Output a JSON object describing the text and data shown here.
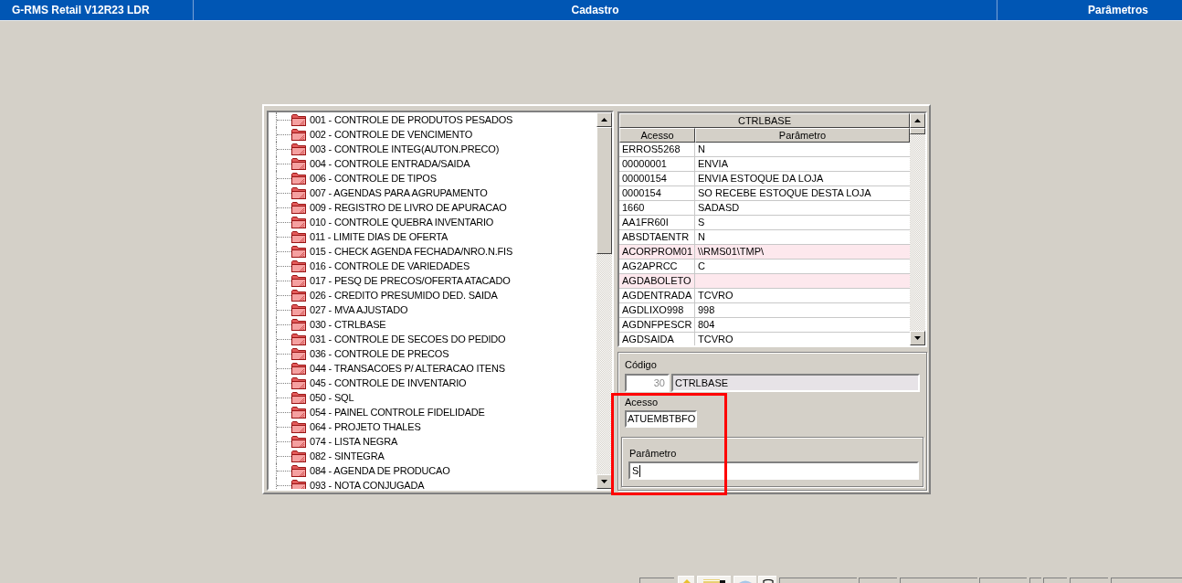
{
  "title_bar": {
    "app_name": "G-RMS Retail V12R23 LDR",
    "module": "Cadastro",
    "screen": "Parâmetros"
  },
  "tree": {
    "items": [
      {
        "label": "001 - CONTROLE DE PRODUTOS PESADOS",
        "selected": false
      },
      {
        "label": "002 - CONTROLE DE VENCIMENTO",
        "selected": false
      },
      {
        "label": "003 - CONTROLE INTEG(AUTON.PRECO)",
        "selected": false
      },
      {
        "label": "004 - CONTROLE ENTRADA/SAIDA",
        "selected": false
      },
      {
        "label": "006 - CONTROLE DE TIPOS",
        "selected": false
      },
      {
        "label": "007 - AGENDAS PARA AGRUPAMENTO",
        "selected": false
      },
      {
        "label": "009 - REGISTRO DE LIVRO DE APURACAO",
        "selected": false
      },
      {
        "label": "010 - CONTROLE QUEBRA INVENTARIO",
        "selected": false
      },
      {
        "label": "011 - LIMITE DIAS DE OFERTA",
        "selected": false
      },
      {
        "label": "015 - CHECK AGENDA FECHADA/NRO.N.FIS",
        "selected": false
      },
      {
        "label": "016 - CONTROLE DE VARIEDADES",
        "selected": false
      },
      {
        "label": "017 - PESQ DE PRECOS/OFERTA ATACADO",
        "selected": false
      },
      {
        "label": "026 - CREDITO PRESUMIDO DED. SAIDA",
        "selected": false
      },
      {
        "label": "027 - MVA AJUSTADO",
        "selected": false
      },
      {
        "label": "030 - CTRLBASE",
        "selected": false
      },
      {
        "label": "031 - CONTROLE DE SECOES DO PEDIDO",
        "selected": false
      },
      {
        "label": "036 - CONTROLE DE PRECOS",
        "selected": false
      },
      {
        "label": "044 - TRANSACOES P/ ALTERACAO ITENS",
        "selected": false
      },
      {
        "label": "045 - CONTROLE DE INVENTARIO",
        "selected": false
      },
      {
        "label": "050 - SQL",
        "selected": false
      },
      {
        "label": "054 - PAINEL CONTROLE FIDELIDADE",
        "selected": false
      },
      {
        "label": "064 - PROJETO THALES",
        "selected": false
      },
      {
        "label": "074 - LISTA NEGRA",
        "selected": false
      },
      {
        "label": "082 - SINTEGRA",
        "selected": false
      },
      {
        "label": "084 - AGENDA DE PRODUCAO",
        "selected": false
      },
      {
        "label": "093 - NOTA CONJUGADA",
        "selected": false
      }
    ]
  },
  "grid": {
    "title": "CTRLBASE",
    "columns": [
      "Acesso",
      "Parâmetro"
    ],
    "rows": [
      {
        "cells": [
          "ERROS5268",
          "N"
        ],
        "highlighted": false
      },
      {
        "cells": [
          "00000001",
          "ENVIA"
        ],
        "highlighted": false
      },
      {
        "cells": [
          "00000154",
          "ENVIA ESTOQUE DA LOJA"
        ],
        "highlighted": false
      },
      {
        "cells": [
          "0000154",
          "SO RECEBE ESTOQUE DESTA LOJA"
        ],
        "highlighted": false
      },
      {
        "cells": [
          "1660",
          "SADASD"
        ],
        "highlighted": false
      },
      {
        "cells": [
          "AA1FR60I",
          "S"
        ],
        "highlighted": false
      },
      {
        "cells": [
          "ABSDTAENTR",
          "N"
        ],
        "highlighted": false
      },
      {
        "cells": [
          "ACORPROM01",
          "\\\\RMS01\\TMP\\"
        ],
        "highlighted": true
      },
      {
        "cells": [
          "AG2APRCC",
          "C"
        ],
        "highlighted": false
      },
      {
        "cells": [
          "AGDABOLETO"
        ],
        "highlighted": true
      },
      {
        "cells": [
          "AGDENTRADA",
          "TCVRO"
        ],
        "highlighted": false
      },
      {
        "cells": [
          "AGDLIXO998",
          "998"
        ],
        "highlighted": false
      },
      {
        "cells": [
          "AGDNFPESCR",
          "804"
        ],
        "highlighted": false
      },
      {
        "cells": [
          "AGDSAIDA",
          "TCVRO"
        ],
        "highlighted": false
      }
    ]
  },
  "form": {
    "highlighted": true,
    "codigo": {
      "label": "Código",
      "number": "30",
      "name": "CTRLBASE",
      "disabled": true
    },
    "acesso": {
      "label": "Acesso",
      "value": "ATUEMBTBFO"
    },
    "parametro": {
      "label": "Parâmetro",
      "value": "S",
      "focused": true
    }
  }
}
